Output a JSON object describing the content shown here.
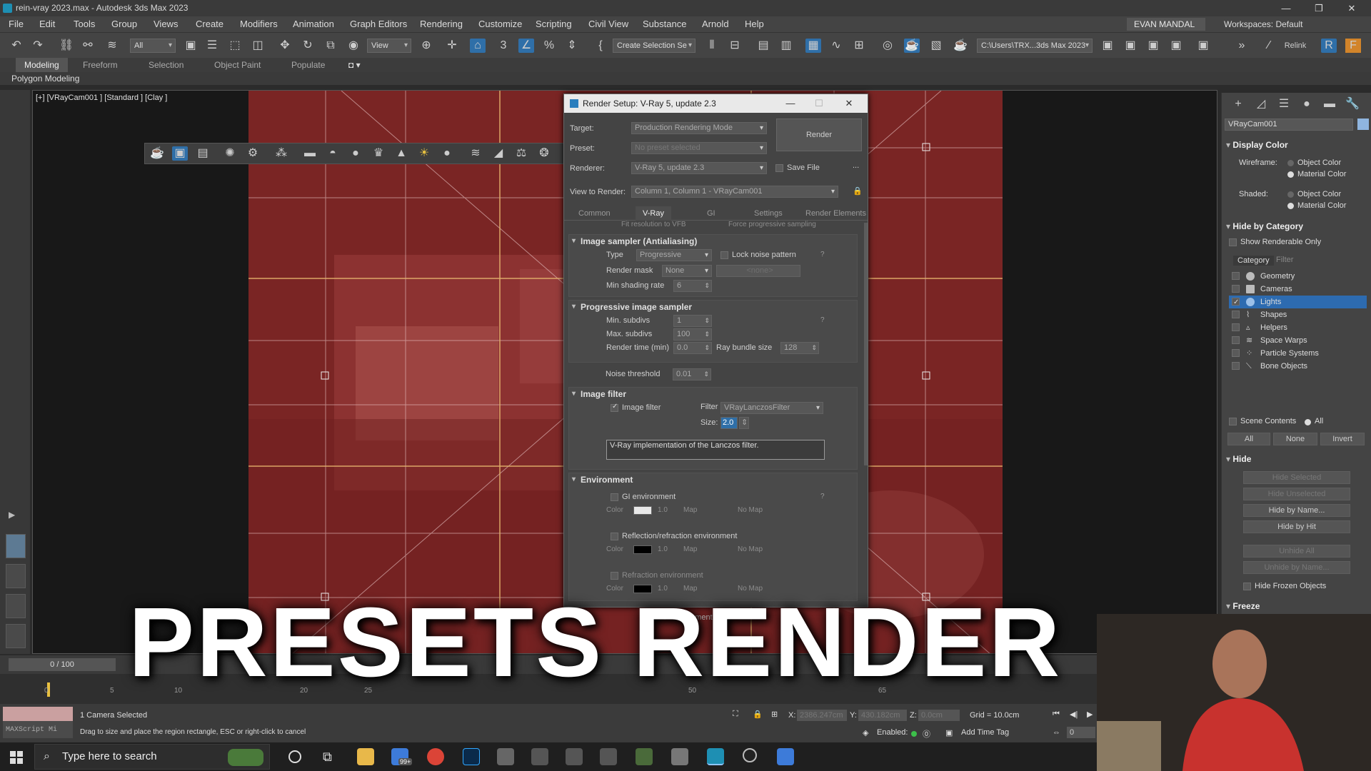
{
  "window": {
    "title": "rein-vray 2023.max - Autodesk 3ds Max 2023",
    "controls": [
      "—",
      "❐",
      "✕"
    ]
  },
  "menu": [
    "File",
    "Edit",
    "Tools",
    "Group",
    "Views",
    "Create",
    "Modifiers",
    "Animation",
    "Graph Editors",
    "Rendering",
    "Customize",
    "Scripting",
    "Civil View",
    "Substance",
    "Arnold",
    "Help"
  ],
  "user": "EVAN MANDAL",
  "workspaces": "Workspaces: Default",
  "toolbar": {
    "selection_filter": "All",
    "view_dropdown": "View",
    "create_selection_set": "Create Selection Se",
    "project_path": "C:\\Users\\TRX...3ds Max 2023",
    "relink": "Relink"
  },
  "ribbon": {
    "tabs": [
      "Modeling",
      "Freeform",
      "Selection",
      "Object Paint",
      "Populate"
    ],
    "active_tab": "Modeling",
    "sub": "Polygon Modeling"
  },
  "viewport": {
    "label": "[+] [VRayCam001 ] [Standard ] [Clay ]"
  },
  "dialog": {
    "title": "Render Setup: V-Ray 5, update 2.3",
    "target_label": "Target:",
    "target_value": "Production Rendering Mode",
    "preset_label": "Preset:",
    "preset_value": "No preset selected",
    "renderer_label": "Renderer:",
    "renderer_value": "V-Ray 5, update 2.3",
    "save_file": "Save File",
    "more": "...",
    "view_label": "View to Render:",
    "view_value": "Column 1, Column 1 - VRayCam001",
    "render_button": "Render",
    "tabs": [
      "Common",
      "V-Ray",
      "GI",
      "Settings",
      "Render Elements"
    ],
    "active_tab": "V-Ray",
    "cutoff_row": [
      "Fit resolution to VFB",
      "Force progressive sampling"
    ],
    "image_sampler": {
      "title": "Image sampler (Antialiasing)",
      "type_label": "Type",
      "type_value": "Progressive",
      "lock_noise": "Lock noise pattern",
      "render_mask_label": "Render mask",
      "render_mask_value": "None",
      "mask_none": "<none>",
      "min_shading_label": "Min shading rate",
      "min_shading_value": "6",
      "help": "?"
    },
    "progressive": {
      "title": "Progressive image sampler",
      "min_subdivs_label": "Min. subdivs",
      "min_subdivs_value": "1",
      "max_subdivs_label": "Max. subdivs",
      "max_subdivs_value": "100",
      "render_time_label": "Render time (min)",
      "render_time_value": "0.0",
      "ray_bundle_label": "Ray bundle size",
      "ray_bundle_value": "128",
      "noise_label": "Noise threshold",
      "noise_value": "0.01",
      "help": "?"
    },
    "image_filter": {
      "title": "Image filter",
      "checkbox_label": "Image filter",
      "filter_label": "Filter",
      "filter_value": "VRayLanczosFilter",
      "size_label": "Size:",
      "size_value": "2.0",
      "description": "V-Ray implementation of the Lanczos filter."
    },
    "environment": {
      "title": "Environment",
      "gi_env": "GI environment",
      "color_label": "Color",
      "mult_value": "1.0",
      "map_label": "Map",
      "no_map": "No Map",
      "refl_env": "Reflection/refraction environment",
      "refr_env": "Refraction environment",
      "secondary_partial": "e environment",
      "help": "?",
      "gi_color": "#e8e8e8",
      "refl_color": "#000000"
    }
  },
  "command_panel": {
    "object_name": "VRayCam001",
    "display_color": "Display Color",
    "wireframe_label": "Wireframe:",
    "shaded_label": "Shaded:",
    "object_color": "Object Color",
    "material_color": "Material Color",
    "hide_by_category": "Hide by Category",
    "show_renderable": "Show Renderable Only",
    "tabs": [
      "Category",
      "Filter"
    ],
    "categories": [
      {
        "name": "Geometry",
        "checked": false,
        "selected": false
      },
      {
        "name": "Cameras",
        "checked": false,
        "selected": false
      },
      {
        "name": "Lights",
        "checked": true,
        "selected": true
      },
      {
        "name": "Shapes",
        "checked": false,
        "selected": false
      },
      {
        "name": "Helpers",
        "checked": false,
        "selected": false
      },
      {
        "name": "Space Warps",
        "checked": false,
        "selected": false
      },
      {
        "name": "Particle Systems",
        "checked": false,
        "selected": false
      },
      {
        "name": "Bone Objects",
        "checked": false,
        "selected": false
      }
    ],
    "scene_contents": "Scene Contents",
    "all_radio": "All",
    "buttons_row": [
      "All",
      "None",
      "Invert"
    ],
    "hide_title": "Hide",
    "hide_buttons": [
      "Hide Selected",
      "Hide Unselected",
      "Hide by Name...",
      "Hide by Hit",
      "Unhide All",
      "Unhide by Name..."
    ],
    "hide_frozen": "Hide Frozen Objects",
    "freeze_title": "Freeze"
  },
  "timeline": {
    "frame": "0 / 100",
    "ticks": [
      "0",
      "5",
      "10",
      "20",
      "25",
      "50",
      "65"
    ]
  },
  "status": {
    "maxscript": "MAXScript Mi",
    "selected": "1 Camera Selected",
    "prompt": "Drag to size and place the region rectangle, ESC or right-click to cancel",
    "x_label": "X:",
    "x_value": "2386.247cm",
    "y_label": "Y:",
    "y_value": "430.182cm",
    "z_label": "Z:",
    "z_value": "0.0cm",
    "grid": "Grid = 10.0cm",
    "enabled": "Enabled:",
    "add_time_tag": "Add Time Tag",
    "frame_field": "0"
  },
  "taskbar": {
    "search_placeholder": "Type here to search",
    "badge": "99+"
  },
  "overlay_title": "PRESETS RENDER"
}
